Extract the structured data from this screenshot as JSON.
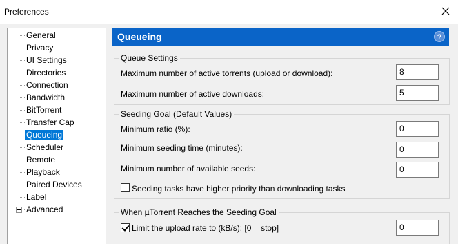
{
  "window": {
    "title": "Preferences"
  },
  "tree": {
    "items": [
      {
        "label": "General"
      },
      {
        "label": "Privacy"
      },
      {
        "label": "UI Settings"
      },
      {
        "label": "Directories"
      },
      {
        "label": "Connection"
      },
      {
        "label": "Bandwidth"
      },
      {
        "label": "BitTorrent"
      },
      {
        "label": "Transfer Cap"
      },
      {
        "label": "Queueing",
        "selected": true
      },
      {
        "label": "Scheduler"
      },
      {
        "label": "Remote"
      },
      {
        "label": "Playback"
      },
      {
        "label": "Paired Devices"
      },
      {
        "label": "Label"
      },
      {
        "label": "Advanced",
        "expandable": true
      }
    ]
  },
  "panel": {
    "title": "Queueing",
    "help_icon": "help-icon",
    "accent_color": "#0a64c8"
  },
  "queue_settings": {
    "title": "Queue Settings",
    "max_active_torrents_label": "Maximum number of active torrents (upload or download):",
    "max_active_torrents_value": "8",
    "max_active_downloads_label": "Maximum number of active downloads:",
    "max_active_downloads_value": "5"
  },
  "seeding_goal": {
    "title": "Seeding Goal (Default Values)",
    "min_ratio_label": "Minimum ratio (%):",
    "min_ratio_value": "0",
    "min_seeding_time_label": "Minimum seeding time (minutes):",
    "min_seeding_time_value": "0",
    "min_available_seeds_label": "Minimum number of available seeds:",
    "min_available_seeds_value": "0",
    "priority_checkbox_label": "Seeding tasks have higher priority than downloading tasks",
    "priority_checked": false
  },
  "reaches_goal": {
    "title": "When µTorrent Reaches the Seeding Goal",
    "limit_upload_label": "Limit the upload rate to (kB/s): [0 = stop]",
    "limit_upload_checked": true,
    "limit_upload_value": "0"
  }
}
